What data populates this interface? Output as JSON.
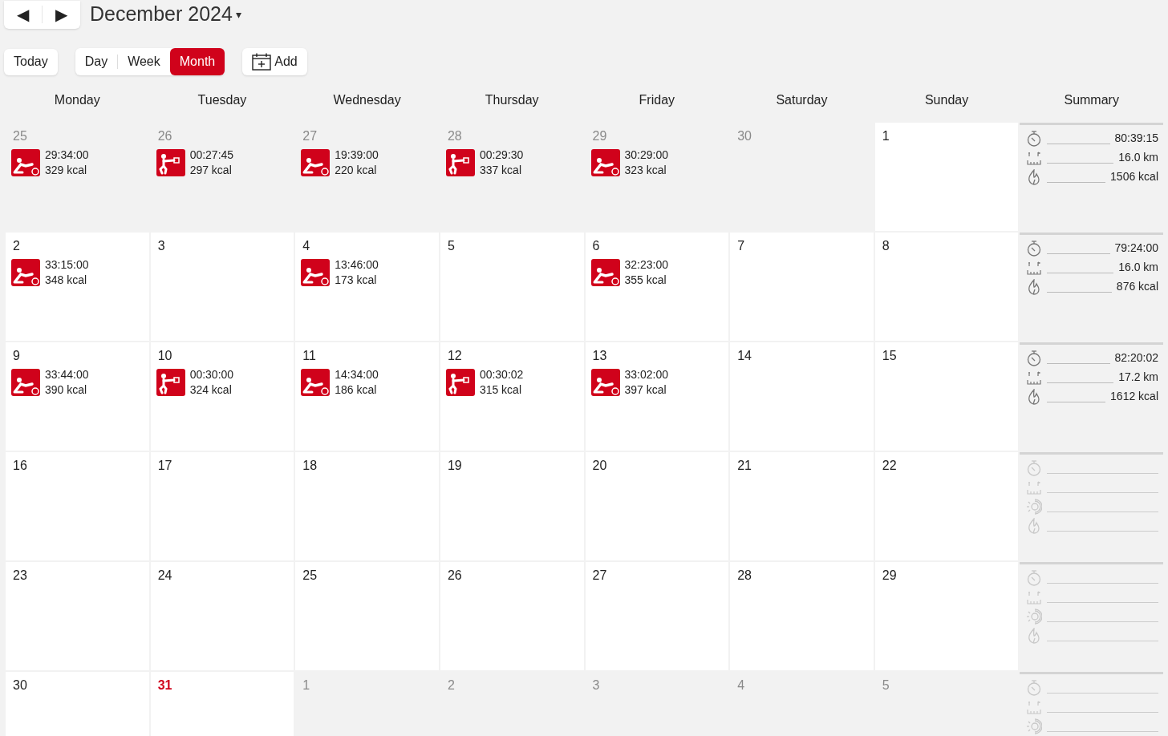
{
  "nav": {
    "prev": "◀",
    "next": "▶"
  },
  "title": "December 2024",
  "title_caret": "▾",
  "today_button": "Today",
  "views": [
    {
      "label": "Day",
      "selected": false
    },
    {
      "label": "Week",
      "selected": false
    },
    {
      "label": "Month",
      "selected": true
    }
  ],
  "add_button": "Add",
  "weekdays": [
    "Monday",
    "Tuesday",
    "Wednesday",
    "Thursday",
    "Friday",
    "Saturday",
    "Sunday",
    "Summary"
  ],
  "weeks": [
    {
      "days": [
        {
          "date": "25",
          "in_month": false,
          "today": false,
          "activities": [
            {
              "kind": "rower",
              "duration": "29:34:00",
              "kcal": "329 kcal"
            }
          ]
        },
        {
          "date": "26",
          "in_month": false,
          "today": false,
          "activities": [
            {
              "kind": "strength",
              "duration": "00:27:45",
              "kcal": "297 kcal"
            }
          ]
        },
        {
          "date": "27",
          "in_month": false,
          "today": false,
          "activities": [
            {
              "kind": "rower",
              "duration": "19:39:00",
              "kcal": "220 kcal"
            }
          ]
        },
        {
          "date": "28",
          "in_month": false,
          "today": false,
          "activities": [
            {
              "kind": "strength",
              "duration": "00:29:30",
              "kcal": "337 kcal"
            }
          ]
        },
        {
          "date": "29",
          "in_month": false,
          "today": false,
          "activities": [
            {
              "kind": "rower",
              "duration": "30:29:00",
              "kcal": "323 kcal"
            }
          ]
        },
        {
          "date": "30",
          "in_month": false,
          "today": false
        },
        {
          "date": "1",
          "in_month": true,
          "today": false
        }
      ],
      "summary": [
        {
          "kind": "time",
          "value": "80:39:15"
        },
        {
          "kind": "distance",
          "value": "16.0 km"
        },
        {
          "kind": "calories",
          "value": "1506 kcal"
        }
      ]
    },
    {
      "days": [
        {
          "date": "2",
          "in_month": true,
          "today": false,
          "activities": [
            {
              "kind": "rower",
              "duration": "33:15:00",
              "kcal": "348 kcal"
            }
          ]
        },
        {
          "date": "3",
          "in_month": true,
          "today": false
        },
        {
          "date": "4",
          "in_month": true,
          "today": false,
          "activities": [
            {
              "kind": "rower",
              "duration": "13:46:00",
              "kcal": "173 kcal"
            }
          ]
        },
        {
          "date": "5",
          "in_month": true,
          "today": false
        },
        {
          "date": "6",
          "in_month": true,
          "today": false,
          "activities": [
            {
              "kind": "rower",
              "duration": "32:23:00",
              "kcal": "355 kcal"
            }
          ]
        },
        {
          "date": "7",
          "in_month": true,
          "today": false
        },
        {
          "date": "8",
          "in_month": true,
          "today": false
        }
      ],
      "summary": [
        {
          "kind": "time",
          "value": "79:24:00"
        },
        {
          "kind": "distance",
          "value": "16.0 km"
        },
        {
          "kind": "calories",
          "value": "876 kcal"
        }
      ]
    },
    {
      "days": [
        {
          "date": "9",
          "in_month": true,
          "today": false,
          "activities": [
            {
              "kind": "rower",
              "duration": "33:44:00",
              "kcal": "390 kcal"
            }
          ]
        },
        {
          "date": "10",
          "in_month": true,
          "today": false,
          "activities": [
            {
              "kind": "strength",
              "duration": "00:30:00",
              "kcal": "324 kcal"
            }
          ]
        },
        {
          "date": "11",
          "in_month": true,
          "today": false,
          "activities": [
            {
              "kind": "rower",
              "duration": "14:34:00",
              "kcal": "186 kcal"
            }
          ]
        },
        {
          "date": "12",
          "in_month": true,
          "today": false,
          "activities": [
            {
              "kind": "strength",
              "duration": "00:30:02",
              "kcal": "315 kcal"
            }
          ]
        },
        {
          "date": "13",
          "in_month": true,
          "today": false,
          "activities": [
            {
              "kind": "rower",
              "duration": "33:02:00",
              "kcal": "397 kcal"
            }
          ]
        },
        {
          "date": "14",
          "in_month": true,
          "today": false
        },
        {
          "date": "15",
          "in_month": true,
          "today": false
        }
      ],
      "summary": [
        {
          "kind": "time",
          "value": "82:20:02"
        },
        {
          "kind": "distance",
          "value": "17.2 km"
        },
        {
          "kind": "calories",
          "value": "1612 kcal"
        }
      ]
    },
    {
      "days": [
        {
          "date": "16",
          "in_month": true,
          "today": false
        },
        {
          "date": "17",
          "in_month": true,
          "today": false
        },
        {
          "date": "18",
          "in_month": true,
          "today": false
        },
        {
          "date": "19",
          "in_month": true,
          "today": false
        },
        {
          "date": "20",
          "in_month": true,
          "today": false
        },
        {
          "date": "21",
          "in_month": true,
          "today": false
        },
        {
          "date": "22",
          "in_month": true,
          "today": false
        }
      ],
      "summary": [
        {
          "kind": "time"
        },
        {
          "kind": "distance"
        },
        {
          "kind": "power"
        },
        {
          "kind": "calories"
        }
      ]
    },
    {
      "days": [
        {
          "date": "23",
          "in_month": true,
          "today": false
        },
        {
          "date": "24",
          "in_month": true,
          "today": false
        },
        {
          "date": "25",
          "in_month": true,
          "today": false
        },
        {
          "date": "26",
          "in_month": true,
          "today": false
        },
        {
          "date": "27",
          "in_month": true,
          "today": false
        },
        {
          "date": "28",
          "in_month": true,
          "today": false
        },
        {
          "date": "29",
          "in_month": true,
          "today": false
        }
      ],
      "summary": [
        {
          "kind": "time"
        },
        {
          "kind": "distance"
        },
        {
          "kind": "power"
        },
        {
          "kind": "calories"
        }
      ]
    },
    {
      "days": [
        {
          "date": "30",
          "in_month": true,
          "today": false
        },
        {
          "date": "31",
          "in_month": true,
          "today": true
        },
        {
          "date": "1",
          "in_month": false,
          "today": false
        },
        {
          "date": "2",
          "in_month": false,
          "today": false
        },
        {
          "date": "3",
          "in_month": false,
          "today": false
        },
        {
          "date": "4",
          "in_month": false,
          "today": false
        },
        {
          "date": "5",
          "in_month": false,
          "today": false
        }
      ],
      "summary": [
        {
          "kind": "time"
        },
        {
          "kind": "distance"
        },
        {
          "kind": "power"
        }
      ]
    }
  ]
}
